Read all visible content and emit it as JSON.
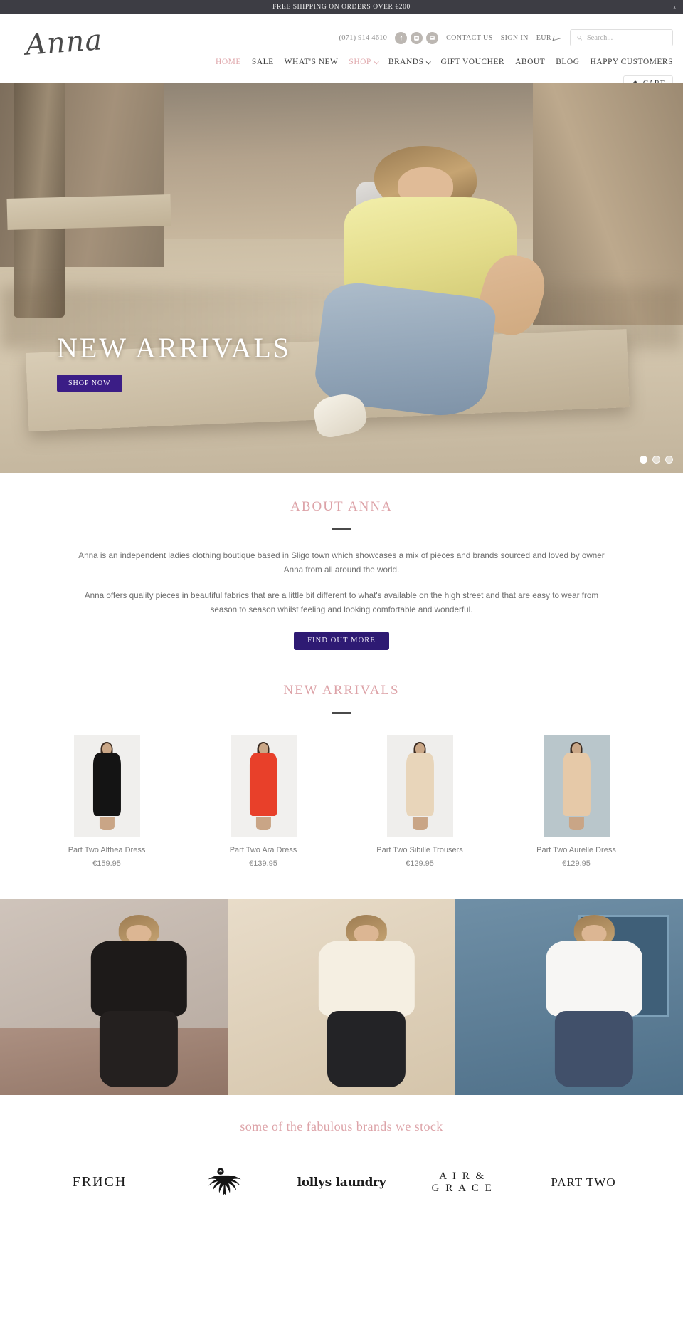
{
  "announcement": {
    "text": "FREE SHIPPING ON ORDERS OVER €200",
    "close_label": "x"
  },
  "header": {
    "logo": "Anna",
    "phone": "(071) 914 4610",
    "socials": [
      {
        "name": "facebook-icon",
        "label": "Facebook"
      },
      {
        "name": "instagram-icon",
        "label": "Instagram"
      },
      {
        "name": "email-icon",
        "label": "Email"
      }
    ],
    "contact_label": "CONTACT US",
    "signin_label": "SIGN IN",
    "currency": "EUR",
    "search_placeholder": "Search...",
    "search_value": "",
    "cart_label": "CART"
  },
  "nav": {
    "items": [
      {
        "label": "HOME",
        "active": true,
        "caret": false
      },
      {
        "label": "SALE",
        "active": false,
        "caret": false
      },
      {
        "label": "WHAT'S NEW",
        "active": false,
        "caret": false
      },
      {
        "label": "SHOP",
        "active": true,
        "caret": true
      },
      {
        "label": "BRANDS",
        "active": false,
        "caret": true
      },
      {
        "label": "GIFT VOUCHER",
        "active": false,
        "caret": false
      },
      {
        "label": "ABOUT",
        "active": false,
        "caret": false
      },
      {
        "label": "BLOG",
        "active": false,
        "caret": false
      },
      {
        "label": "HAPPY CUSTOMERS",
        "active": false,
        "caret": false
      }
    ]
  },
  "hero": {
    "heading": "NEW ARRIVALS",
    "cta_label": "SHOP NOW",
    "slides": 3,
    "active_slide": 1
  },
  "about": {
    "title": "ABOUT ANNA",
    "paragraph_1": "Anna is an independent ladies clothing boutique based in Sligo town which showcases a mix of pieces and brands sourced and loved by owner Anna from all around the world.",
    "paragraph_2": "Anna offers quality pieces in beautiful fabrics that are a little bit different to what's available on the high street and that are easy to wear from season to season whilst feeling and looking comfortable and wonderful.",
    "cta_label": "FIND OUT MORE",
    "cta_color": "#2e1a73",
    "title_color": "#dda3a8"
  },
  "arrivals": {
    "title": "NEW ARRIVALS",
    "products": [
      {
        "name": "Part Two Althea Dress",
        "price": "€159.95",
        "garment_color": "#141414",
        "bg": "#f0efed"
      },
      {
        "name": "Part Two Ara Dress",
        "price": "€139.95",
        "garment_color": "#e8402a",
        "bg": "#f1f0ee"
      },
      {
        "name": "Part Two Sibille Trousers",
        "price": "€129.95",
        "garment_color": "#e8d5ba",
        "bg": "#efeeec"
      },
      {
        "name": "Part Two Aurelle Dress",
        "price": "€129.95",
        "garment_color": "#e6c9a8",
        "bg": "#b9c6cb"
      }
    ]
  },
  "lookbook": {
    "panels": [
      {
        "name": "leather-jacket-look",
        "top_color": "#1d1a19",
        "bottom_color": "#24201f"
      },
      {
        "name": "cream-blouse-look",
        "top_color": "#f5efe2",
        "bottom_color": "#232326"
      },
      {
        "name": "white-knit-look",
        "top_color": "#f7f6f4",
        "bottom_color": "#41506a"
      }
    ]
  },
  "brands": {
    "title": "some of the fabulous brands we stock",
    "logos": [
      {
        "name": "frnch-logo",
        "text": "FRИCH",
        "style": "frnch"
      },
      {
        "name": "eagle-emblem-logo",
        "text": "",
        "style": "emblem"
      },
      {
        "name": "lollys-laundry-logo",
        "text": "lollys laundry",
        "style": "lollys"
      },
      {
        "name": "air-and-grace-logo",
        "line1": "A I R  &",
        "line2": "G R A C E",
        "style": "air"
      },
      {
        "name": "part-two-logo",
        "text": "PART TWO",
        "style": "parttwo"
      }
    ]
  }
}
